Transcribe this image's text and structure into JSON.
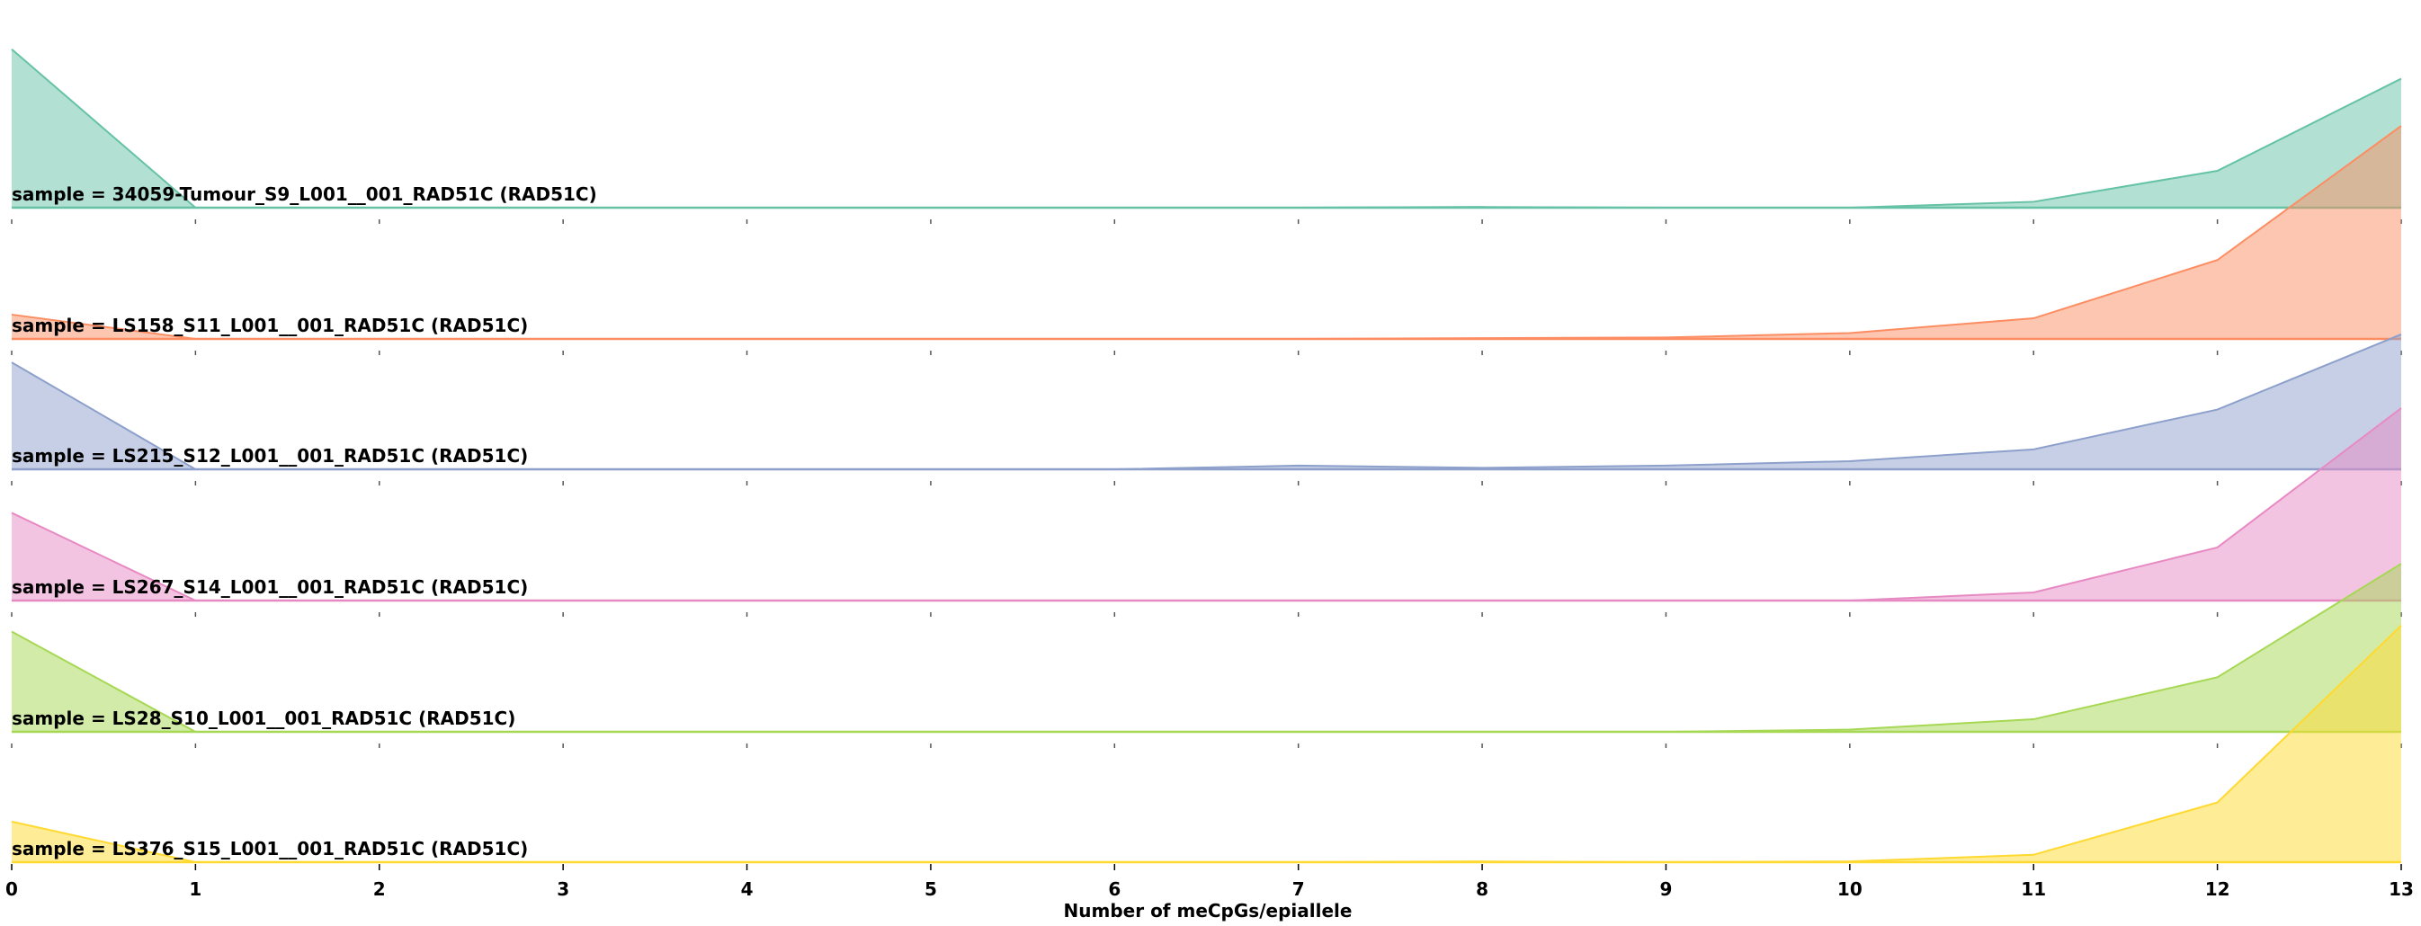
{
  "chart_data": {
    "type": "area",
    "layout": "ridgeline",
    "x": [
      0,
      1,
      2,
      3,
      4,
      5,
      6,
      7,
      8,
      9,
      10,
      11,
      12,
      13
    ],
    "xlabel": "Number of meCpGs/epiallele",
    "xlim": [
      0,
      13
    ],
    "series": [
      {
        "name": "sample = 34059-Tumour_S9_L001__001_RAD51C (RAD51C)",
        "color": "#66c2a5",
        "values": [
          0.215,
          0.0,
          0.0,
          0.0,
          0.0,
          0.0,
          0.0,
          0.0,
          0.001,
          0.0,
          0.0,
          0.008,
          0.05,
          0.175
        ]
      },
      {
        "name": "sample = LS158_S11_L001__001_RAD51C (RAD51C)",
        "color": "#fc8d62",
        "values": [
          0.033,
          0.0,
          0.0,
          0.0,
          0.0,
          0.0,
          0.0,
          0.0,
          0.001,
          0.002,
          0.008,
          0.028,
          0.107,
          0.289
        ]
      },
      {
        "name": "sample = LS215_S12_L001__001_RAD51C (RAD51C)",
        "color": "#8da0cb",
        "values": [
          0.145,
          0.0,
          0.0,
          0.0,
          0.0,
          0.0,
          0.0,
          0.005,
          0.002,
          0.005,
          0.011,
          0.027,
          0.081,
          0.183
        ]
      },
      {
        "name": "sample = LS267_S14_L001__001_RAD51C (RAD51C)",
        "color": "#e78ac3",
        "values": [
          0.119,
          0.0,
          0.0,
          0.0,
          0.0,
          0.0,
          0.0,
          0.0,
          0.0,
          0.0,
          0.0,
          0.011,
          0.072,
          0.261
        ]
      },
      {
        "name": "sample = LS28_S10_L001__001_RAD51C (RAD51C)",
        "color": "#a6d854",
        "values": [
          0.136,
          0.0,
          0.0,
          0.0,
          0.0,
          0.0,
          0.0,
          0.0,
          0.0,
          0.0,
          0.003,
          0.017,
          0.074,
          0.228
        ]
      },
      {
        "name": "sample = LS376_S15_L001__001_RAD51C (RAD51C)",
        "color": "#ffd92f",
        "values": [
          0.055,
          0.0,
          0.0,
          0.0,
          0.0,
          0.0,
          0.0,
          0.0,
          0.001,
          0.0,
          0.001,
          0.01,
          0.081,
          0.321
        ]
      }
    ],
    "fill_alpha": 0.5,
    "grid": false
  }
}
